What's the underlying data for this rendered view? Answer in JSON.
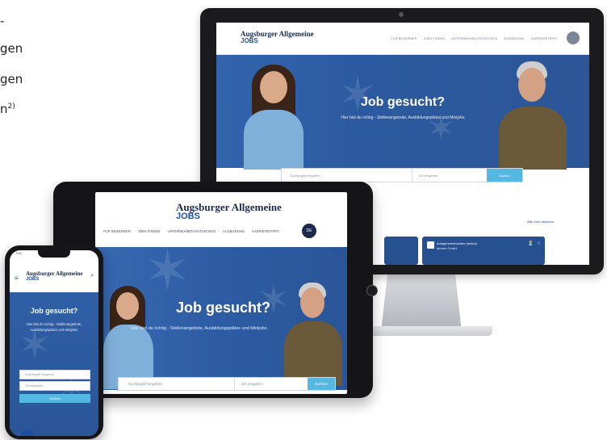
{
  "left_text": {
    "line1": "-",
    "line2": "gen",
    "line3": "gen",
    "line4": "n",
    "line4_sup": "2)"
  },
  "brand": {
    "name": "Augsburger Allgemeine",
    "sub": "JOBS",
    "primary_color": "#2b5697",
    "accent_color": "#55b8e3",
    "dark_navy": "#1c2b4a"
  },
  "hero": {
    "title": "Job gesucht?",
    "subtitle_desktop": "Hier bist du richtig - Stellenangebote, Ausbildungsplätze und Minijobs",
    "subtitle_mobile": "Hier bist du richtig - Stellenangebote, Ausbildungsplätze und Minijobs."
  },
  "nav": {
    "items": [
      "FÜR BEWERBER",
      "JOBS FINDEN",
      "UNTERNEHMEN ENTDECKEN",
      "AUSBILDUNG",
      "KARRIERETIPPS"
    ],
    "avatar_label": "DE"
  },
  "search": {
    "what_placeholder": "Suchbegriff eingeben",
    "where_placeholder": "Ort eingeben",
    "button_label": "Suchen"
  },
  "monitor": {
    "all_jobs_link": "Alle Jobs ansehen",
    "card_title": "Anlagenmechaniker (m/w/d)",
    "card_company": "Muster GmbH"
  },
  "phone": {
    "status_time": "9:41"
  }
}
